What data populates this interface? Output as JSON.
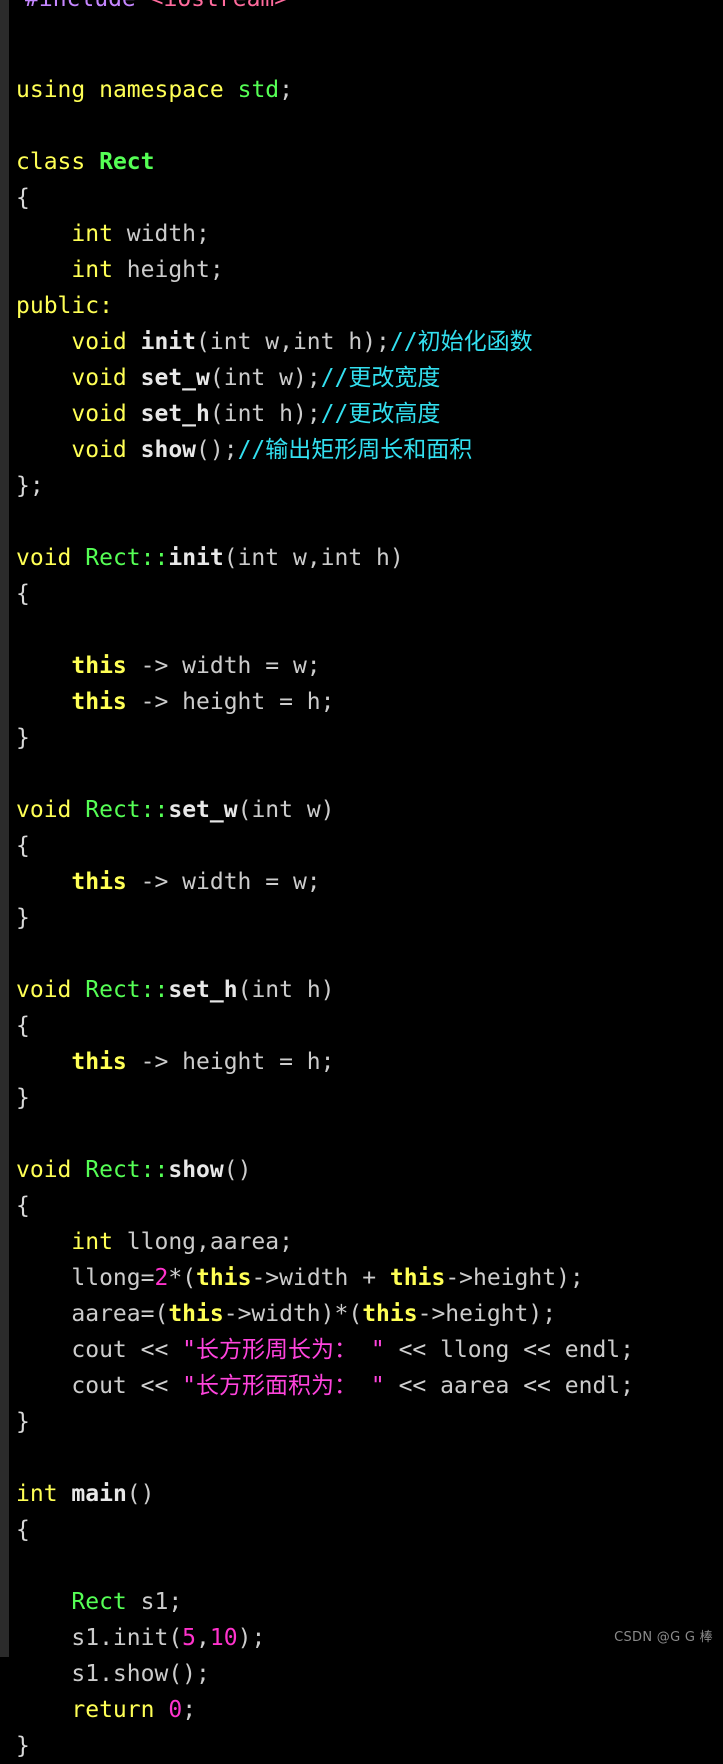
{
  "editor": {
    "language": "C++",
    "background": "#000000",
    "gutter_color": "#2b2b2b",
    "colors": {
      "keyword": "#ffff55",
      "type": "#55ff55",
      "function": "#e8e8e8",
      "identifier": "#cccccc",
      "comment": "#33e0f0",
      "string": "#ff44dd",
      "number": "#ff33cc",
      "preprocessor": "#c586ff",
      "punctuation": "#d0d0d0"
    }
  },
  "code": {
    "line_1_include": "#include",
    "line_1_header": "<iostream>",
    "kw_using": "using",
    "kw_namespace": "namespace",
    "std": "std",
    "semi": ";",
    "kw_class": "class",
    "class_name": "Rect",
    "brace_open": "{",
    "brace_close": "}",
    "brace_close_semi": "};",
    "kw_int": "int",
    "kw_void": "void",
    "kw_public": "public:",
    "kw_this": "this",
    "kw_return": "return",
    "member_width": "width;",
    "member_height": "height;",
    "decl_init": "init",
    "decl_init_params": "(int w,int h);",
    "comment_init": "//初始化函数",
    "decl_set_w": "set_w",
    "decl_set_w_params": "(int w);",
    "comment_set_w": "//更改宽度",
    "decl_set_h": "set_h",
    "decl_set_h_params": "(int h);",
    "comment_set_h": "//更改高度",
    "decl_show": "show",
    "decl_show_params": "();",
    "comment_show": "//输出矩形周长和面积",
    "scope_rect": "Rect::",
    "def_init_params": "(int w,int h)",
    "def_set_w_params": "(int w)",
    "def_set_h_params": "(int h)",
    "def_show_params": "()",
    "assign_this_width_w": " -> width = w;",
    "assign_this_height_h": " -> height = h;",
    "decl_locals": "llong,aarea;",
    "expr_llong_a": "llong=",
    "expr_llong_num": "2",
    "expr_llong_b": "*(",
    "expr_llong_c": "->width + ",
    "expr_llong_d": "->height);",
    "expr_aarea_a": "aarea=(",
    "expr_aarea_b": "->width)*(",
    "expr_aarea_c": "->height);",
    "cout": "cout",
    "shift": " << ",
    "str_perimeter": "\"长方形周长为： \"",
    "var_llong": "llong",
    "var_aarea": "aarea",
    "endl": "endl;",
    "main_name": "main",
    "main_params": "()",
    "obj_decl": "s1;",
    "call_init_a": "s1.init(",
    "call_init_n1": "5",
    "call_init_comma": ",",
    "call_init_n2": "10",
    "call_init_b": ");",
    "call_show": "s1.show();",
    "return_zero": "0",
    "str_area": "\"长方形面积为： \""
  },
  "watermark": {
    "text": "CSDN @G G 棒"
  }
}
